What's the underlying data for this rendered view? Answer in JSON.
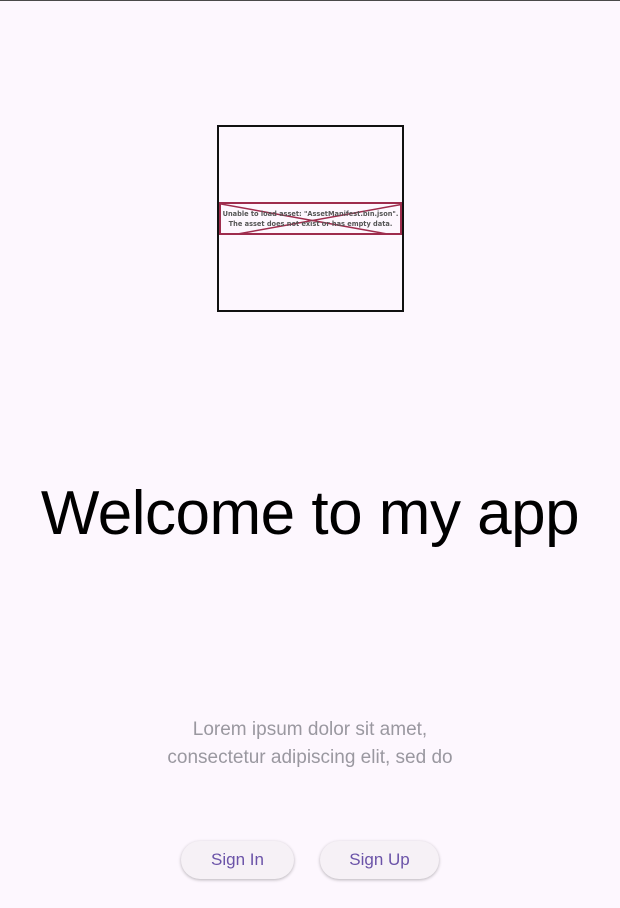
{
  "logo": {
    "error_line_1": "Unable to load asset: \"AssetManifest.bin.json\".",
    "error_line_2": "The asset does not exist or has empty data.",
    "error_color": "#9E2C4D"
  },
  "welcome": {
    "title": "Welcome to my app",
    "subtitle_line_1": "Lorem ipsum dolor sit amet,",
    "subtitle_line_2": "consectetur adipiscing elit, sed do"
  },
  "actions": {
    "sign_in_label": "Sign In",
    "sign_up_label": "Sign Up"
  },
  "colors": {
    "background": "#FDF7FE",
    "button_text": "#6B53A8",
    "subtitle_text": "#9A98A0"
  }
}
